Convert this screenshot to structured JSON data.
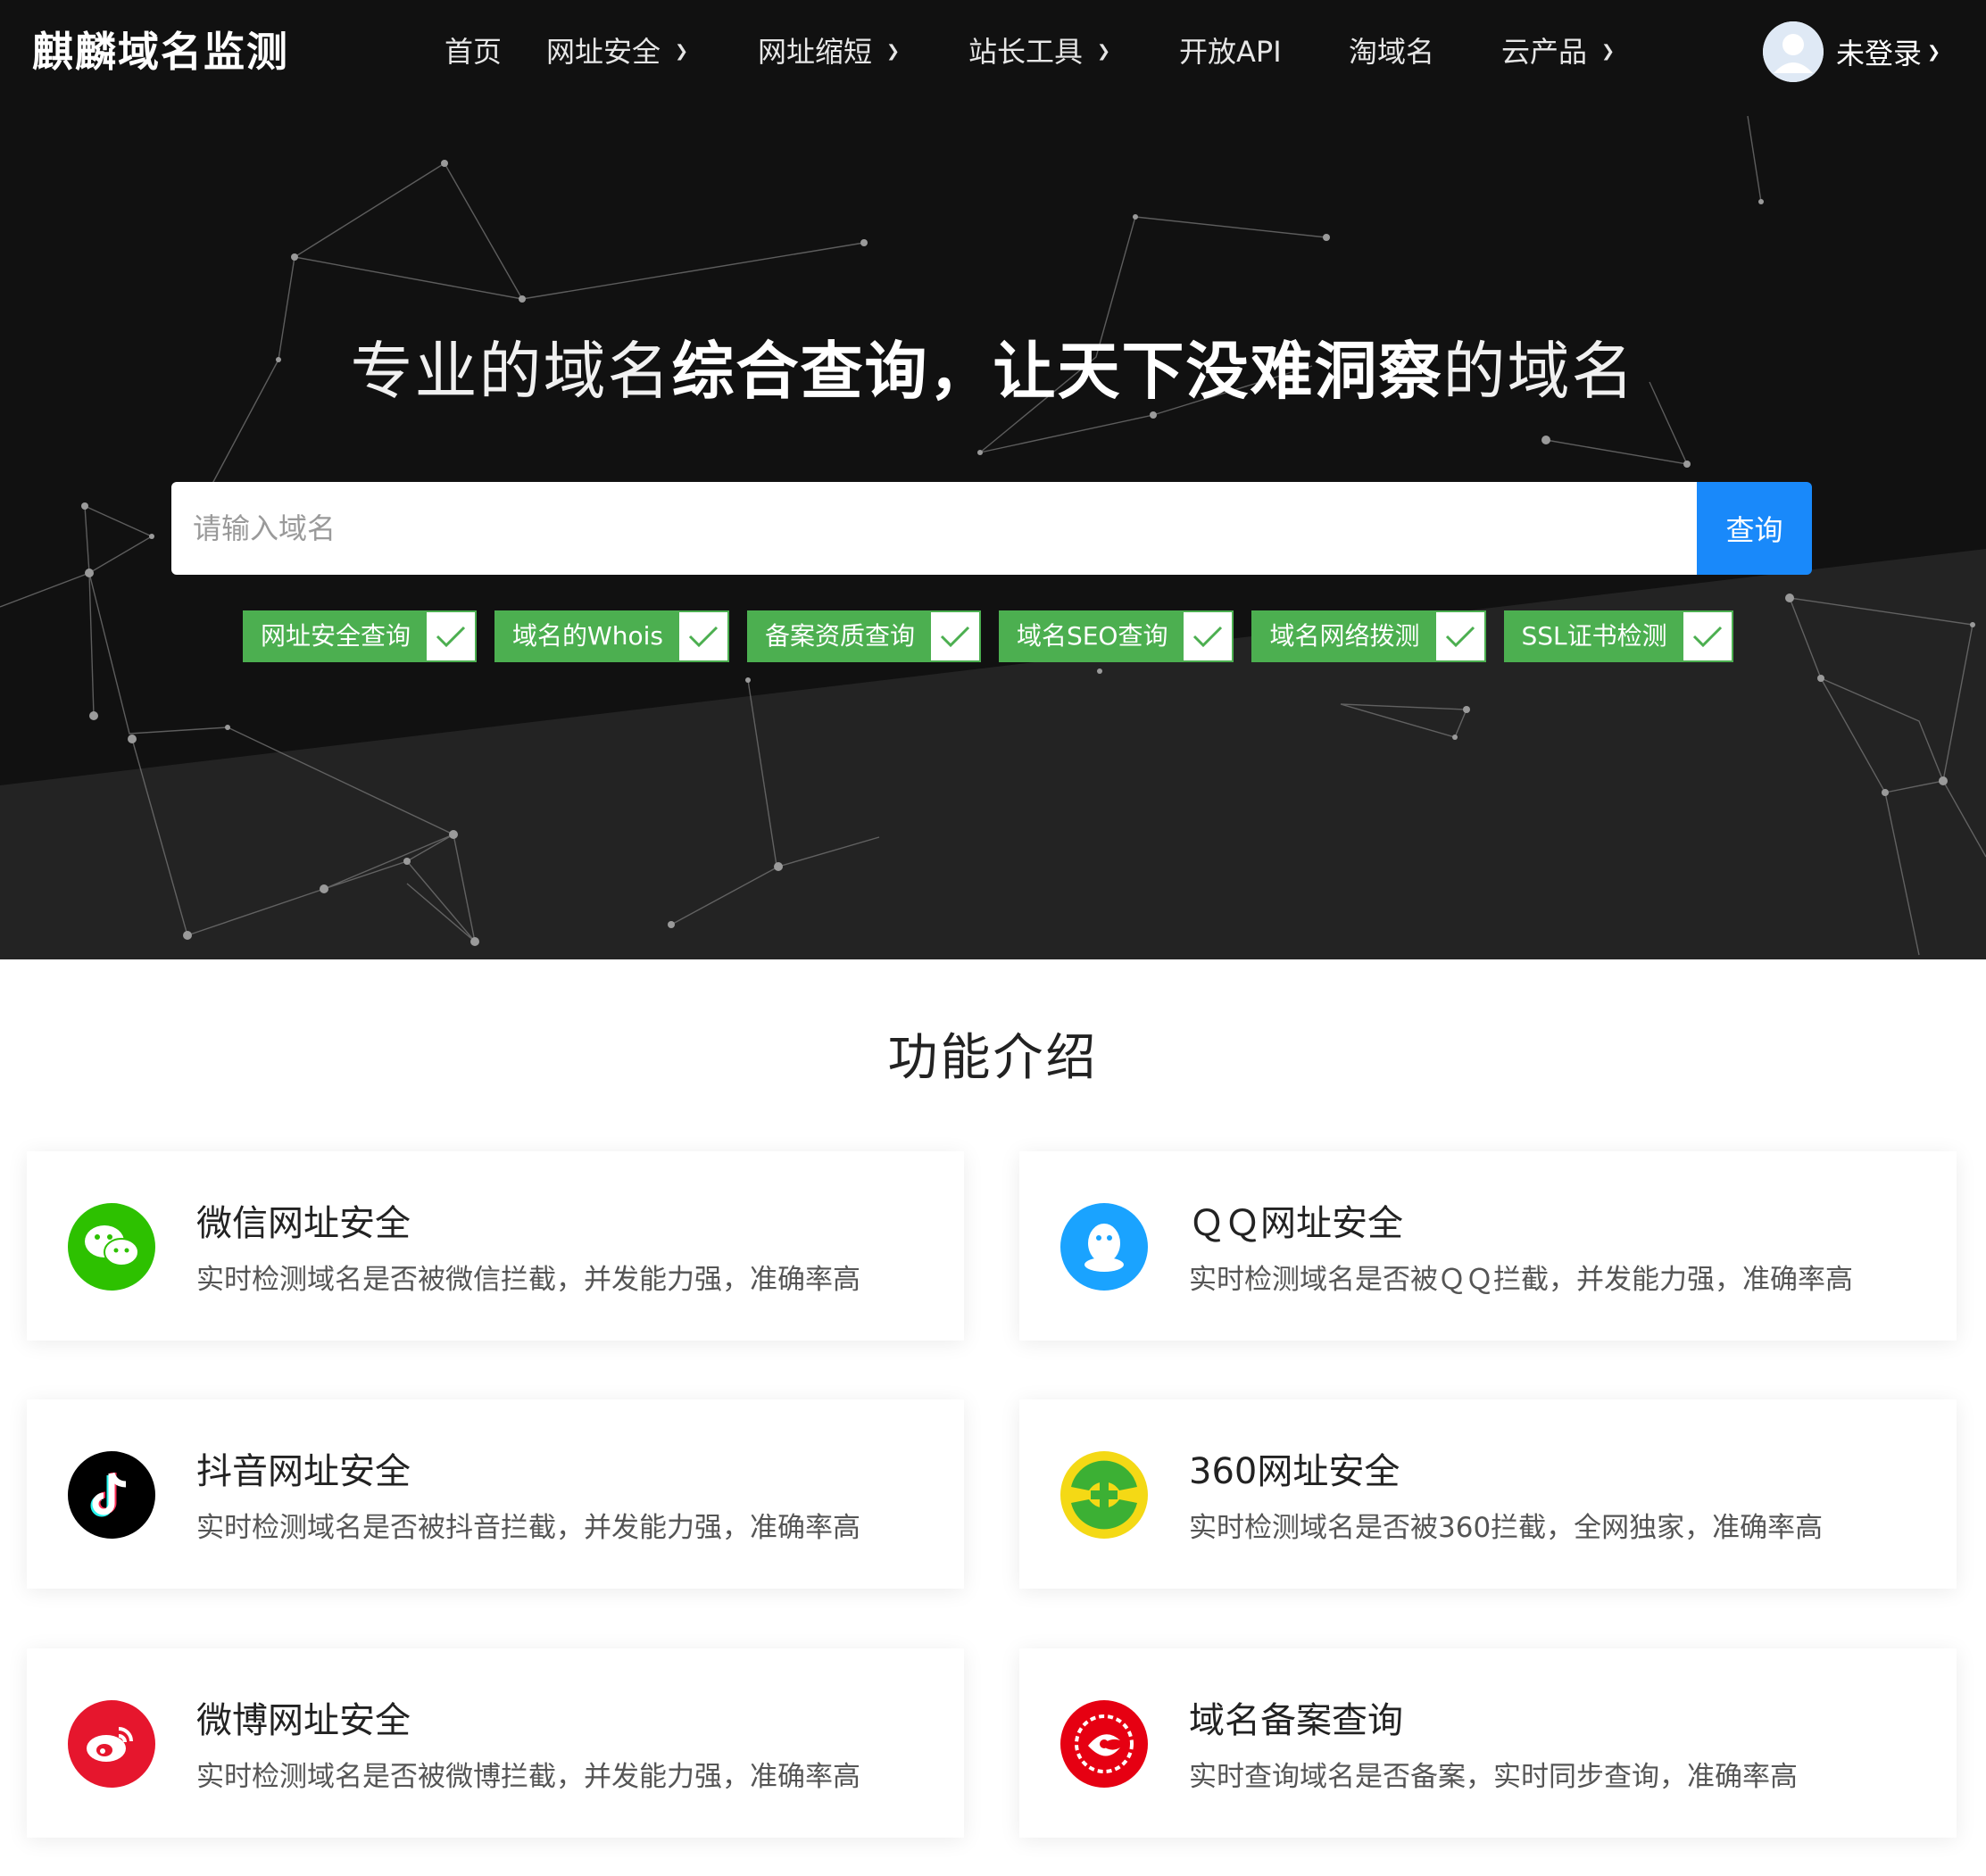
{
  "brand": {
    "logo": "麒麟域名监测"
  },
  "nav": {
    "items": [
      {
        "label": "首页",
        "dropdown": false
      },
      {
        "label": "网址安全",
        "dropdown": true
      },
      {
        "label": "网址缩短",
        "dropdown": true
      },
      {
        "label": "站长工具",
        "dropdown": true
      },
      {
        "label": "开放API",
        "dropdown": false
      },
      {
        "label": "淘域名",
        "dropdown": false
      },
      {
        "label": "云产品",
        "dropdown": true
      }
    ],
    "user": {
      "label": "未登录"
    }
  },
  "hero": {
    "slogan": {
      "part1": "专业的域名",
      "part2": "综合查询，让天下没难洞察",
      "part3": "的域名"
    },
    "search": {
      "placeholder": "请输入域名",
      "button": "查询"
    },
    "tags": [
      {
        "label": "网址安全查询",
        "checked": true
      },
      {
        "label": "域名的Whois",
        "checked": true
      },
      {
        "label": "备案资质查询",
        "checked": true
      },
      {
        "label": "域名SEO查询",
        "checked": true
      },
      {
        "label": "域名网络拨测",
        "checked": true
      },
      {
        "label": "SSL证书检测",
        "checked": true
      }
    ]
  },
  "features": {
    "title": "功能介绍",
    "cards": [
      {
        "icon": "wechat-icon",
        "color": "#2dc100",
        "title": "微信网址安全",
        "desc": "实时检测域名是否被微信拦截，并发能力强，准确率高"
      },
      {
        "icon": "qq-icon",
        "color": "#1aa3ff",
        "title": "ＱＱ网址安全",
        "desc": "实时检测域名是否被ＱＱ拦截，并发能力强，准确率高"
      },
      {
        "icon": "douyin-icon",
        "color": "#000000",
        "title": "抖音网址安全",
        "desc": "实时检测域名是否被抖音拦截，并发能力强，准确率高"
      },
      {
        "icon": "360-icon",
        "color": "#3cb034",
        "title": "360网址安全",
        "desc": "实时检测域名是否被360拦截，全网独家，准确率高"
      },
      {
        "icon": "weibo-icon",
        "color": "#e6162d",
        "title": "微博网址安全",
        "desc": "实时检测域名是否被微博拦截，并发能力强，准确率高"
      },
      {
        "icon": "beian-icon",
        "color": "#e60012",
        "title": "域名备案查询",
        "desc": "实时查询域名是否备案，实时同步查询，准确率高"
      }
    ]
  }
}
